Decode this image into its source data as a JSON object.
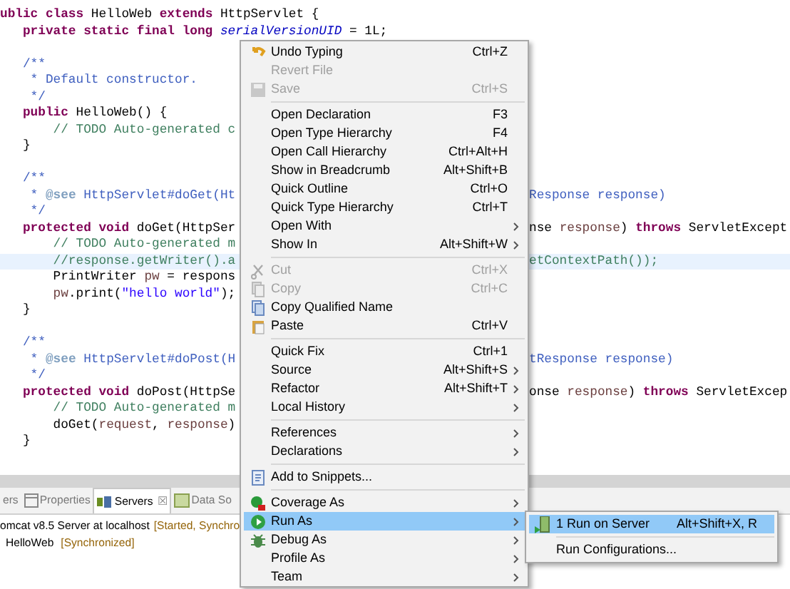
{
  "editor": {
    "lines": [
      {
        "current": false,
        "left": [
          {
            "kind": "keyword",
            "text": "ublic class"
          },
          {
            "kind": "plain",
            "text": " HelloWeb "
          },
          {
            "kind": "keyword",
            "text": "extends"
          },
          {
            "kind": "plain",
            "text": " HttpServlet {"
          }
        ]
      },
      {
        "current": false,
        "left": [
          {
            "kind": "keyword",
            "text": "   private static final long"
          },
          {
            "kind": "field",
            "text": " serialVersionUID"
          },
          {
            "kind": "plain",
            "text": " = 1L;"
          }
        ]
      },
      {
        "current": false
      },
      {
        "current": false,
        "left": [
          {
            "kind": "javadoc",
            "text": "   /**"
          }
        ]
      },
      {
        "current": false,
        "left": [
          {
            "kind": "javadoc",
            "text": "    * Default constructor."
          }
        ]
      },
      {
        "current": false,
        "left": [
          {
            "kind": "javadoc",
            "text": "    */"
          }
        ]
      },
      {
        "current": false,
        "left": [
          {
            "kind": "keyword",
            "text": "   public"
          },
          {
            "kind": "plain",
            "text": " HelloWeb() {"
          }
        ]
      },
      {
        "current": false,
        "left": [
          {
            "kind": "comment",
            "text": "       // TODO Auto-generated c"
          }
        ]
      },
      {
        "current": false,
        "left": [
          {
            "kind": "plain",
            "text": "   }"
          }
        ]
      },
      {
        "current": false
      },
      {
        "current": false,
        "left": [
          {
            "kind": "javadoc",
            "text": "   /**"
          }
        ]
      },
      {
        "current": false,
        "left": [
          {
            "kind": "javadoc",
            "text": "    * "
          },
          {
            "kind": "doctag",
            "text": "@see"
          },
          {
            "kind": "javadoc",
            "text": " HttpServlet#doGet(Ht"
          }
        ],
        "right": [
          {
            "kind": "javadoc",
            "text": "Response response)"
          }
        ]
      },
      {
        "current": false,
        "left": [
          {
            "kind": "javadoc",
            "text": "    */"
          }
        ]
      },
      {
        "current": false,
        "left": [
          {
            "kind": "keyword",
            "text": "   protected void"
          },
          {
            "kind": "plain",
            "text": " doGet(HttpSer"
          }
        ],
        "right": [
          {
            "kind": "plain",
            "text": "nse "
          },
          {
            "kind": "param",
            "text": "response"
          },
          {
            "kind": "plain",
            "text": ") "
          },
          {
            "kind": "keyword",
            "text": "throws"
          },
          {
            "kind": "plain",
            "text": " ServletExcept"
          }
        ]
      },
      {
        "current": false,
        "left": [
          {
            "kind": "comment",
            "text": "       // TODO Auto-generated m"
          }
        ]
      },
      {
        "current": true,
        "left": [
          {
            "kind": "comment",
            "text": "       //response.getWriter().a"
          }
        ],
        "right": [
          {
            "kind": "comment",
            "text": "etContextPath());"
          }
        ]
      },
      {
        "current": false,
        "left": [
          {
            "kind": "plain",
            "text": "       PrintWriter "
          },
          {
            "kind": "param",
            "text": "pw"
          },
          {
            "kind": "plain",
            "text": " = respons"
          }
        ]
      },
      {
        "current": false,
        "left": [
          {
            "kind": "param",
            "text": "       pw"
          },
          {
            "kind": "plain",
            "text": ".print("
          },
          {
            "kind": "string",
            "text": "\"hello world\""
          },
          {
            "kind": "plain",
            "text": ");"
          }
        ]
      },
      {
        "current": false,
        "left": [
          {
            "kind": "plain",
            "text": "   }"
          }
        ]
      },
      {
        "current": false
      },
      {
        "current": false,
        "left": [
          {
            "kind": "javadoc",
            "text": "   /**"
          }
        ]
      },
      {
        "current": false,
        "left": [
          {
            "kind": "javadoc",
            "text": "    * "
          },
          {
            "kind": "doctag",
            "text": "@see"
          },
          {
            "kind": "javadoc",
            "text": " HttpServlet#doPost(H"
          }
        ],
        "right": [
          {
            "kind": "javadoc",
            "text": "tResponse response)"
          }
        ]
      },
      {
        "current": false,
        "left": [
          {
            "kind": "javadoc",
            "text": "    */"
          }
        ]
      },
      {
        "current": false,
        "left": [
          {
            "kind": "keyword",
            "text": "   protected void"
          },
          {
            "kind": "plain",
            "text": " doPost(HttpSe"
          }
        ],
        "right": [
          {
            "kind": "plain",
            "text": "onse "
          },
          {
            "kind": "param",
            "text": "response"
          },
          {
            "kind": "plain",
            "text": ") "
          },
          {
            "kind": "keyword",
            "text": "throws"
          },
          {
            "kind": "plain",
            "text": " ServletExcep"
          }
        ]
      },
      {
        "current": false,
        "left": [
          {
            "kind": "comment",
            "text": "       // TODO Auto-generated m"
          }
        ]
      },
      {
        "current": false,
        "left": [
          {
            "kind": "plain",
            "text": "       doGet("
          },
          {
            "kind": "param",
            "text": "request"
          },
          {
            "kind": "plain",
            "text": ", "
          },
          {
            "kind": "param",
            "text": "response"
          },
          {
            "kind": "plain",
            "text": ")"
          }
        ]
      },
      {
        "current": false,
        "left": [
          {
            "kind": "plain",
            "text": "   }"
          }
        ]
      }
    ]
  },
  "bottom_panel": {
    "tabs": [
      {
        "label": "ers",
        "selected": false
      },
      {
        "label": "Properties",
        "selected": false
      },
      {
        "label": "Servers",
        "selected": true,
        "close": "☒"
      },
      {
        "label": "Data So",
        "selected": false
      }
    ],
    "servers": [
      {
        "name": "omcat v8.5 Server at localhost",
        "status": "[Started, Synchro",
        "children": [
          {
            "name": "HelloWeb",
            "status": "[Synchronized]"
          }
        ]
      }
    ]
  },
  "context_menu": {
    "items": [
      {
        "kind": "item",
        "label": "Undo Typing",
        "shortcut": "Ctrl+Z",
        "disabled": false,
        "submenu": false,
        "selected": false
      },
      {
        "kind": "item",
        "label": "Revert File",
        "disabled": true,
        "submenu": false,
        "selected": false
      },
      {
        "kind": "item",
        "label": "Save",
        "shortcut": "Ctrl+S",
        "disabled": true,
        "submenu": false,
        "selected": false
      },
      {
        "kind": "separator"
      },
      {
        "kind": "item",
        "label": "Open Declaration",
        "shortcut": "F3",
        "disabled": false,
        "submenu": false,
        "selected": false
      },
      {
        "kind": "item",
        "label": "Open Type Hierarchy",
        "shortcut": "F4",
        "disabled": false,
        "submenu": false,
        "selected": false
      },
      {
        "kind": "item",
        "label": "Open Call Hierarchy",
        "shortcut": "Ctrl+Alt+H",
        "disabled": false,
        "submenu": false,
        "selected": false
      },
      {
        "kind": "item",
        "label": "Show in Breadcrumb",
        "shortcut": "Alt+Shift+B",
        "disabled": false,
        "submenu": false,
        "selected": false
      },
      {
        "kind": "item",
        "label": "Quick Outline",
        "shortcut": "Ctrl+O",
        "disabled": false,
        "submenu": false,
        "selected": false
      },
      {
        "kind": "item",
        "label": "Quick Type Hierarchy",
        "shortcut": "Ctrl+T",
        "disabled": false,
        "submenu": false,
        "selected": false
      },
      {
        "kind": "item",
        "label": "Open With",
        "disabled": false,
        "submenu": true,
        "selected": false
      },
      {
        "kind": "item",
        "label": "Show In",
        "shortcut": "Alt+Shift+W",
        "disabled": false,
        "submenu": true,
        "selected": false
      },
      {
        "kind": "separator"
      },
      {
        "kind": "item",
        "label": "Cut",
        "shortcut": "Ctrl+X",
        "disabled": true,
        "submenu": false,
        "selected": false
      },
      {
        "kind": "item",
        "label": "Copy",
        "shortcut": "Ctrl+C",
        "disabled": true,
        "submenu": false,
        "selected": false
      },
      {
        "kind": "item",
        "label": "Copy Qualified Name",
        "disabled": false,
        "submenu": false,
        "selected": false
      },
      {
        "kind": "item",
        "label": "Paste",
        "shortcut": "Ctrl+V",
        "disabled": false,
        "submenu": false,
        "selected": false
      },
      {
        "kind": "separator"
      },
      {
        "kind": "item",
        "label": "Quick Fix",
        "shortcut": "Ctrl+1",
        "disabled": false,
        "submenu": false,
        "selected": false
      },
      {
        "kind": "item",
        "label": "Source",
        "shortcut": "Alt+Shift+S",
        "disabled": false,
        "submenu": true,
        "selected": false
      },
      {
        "kind": "item",
        "label": "Refactor",
        "shortcut": "Alt+Shift+T",
        "disabled": false,
        "submenu": true,
        "selected": false
      },
      {
        "kind": "item",
        "label": "Local History",
        "disabled": false,
        "submenu": true,
        "selected": false
      },
      {
        "kind": "separator"
      },
      {
        "kind": "item",
        "label": "References",
        "disabled": false,
        "submenu": true,
        "selected": false
      },
      {
        "kind": "item",
        "label": "Declarations",
        "disabled": false,
        "submenu": true,
        "selected": false
      },
      {
        "kind": "separator"
      },
      {
        "kind": "item",
        "label": "Add to Snippets...",
        "disabled": false,
        "submenu": false,
        "selected": false
      },
      {
        "kind": "separator"
      },
      {
        "kind": "item",
        "label": "Coverage As",
        "disabled": false,
        "submenu": true,
        "selected": false
      },
      {
        "kind": "item",
        "label": "Run As",
        "disabled": false,
        "submenu": true,
        "selected": true
      },
      {
        "kind": "item",
        "label": "Debug As",
        "disabled": false,
        "submenu": true,
        "selected": false
      },
      {
        "kind": "item",
        "label": "Profile As",
        "disabled": false,
        "submenu": true,
        "selected": false
      },
      {
        "kind": "item",
        "label": "Team",
        "disabled": false,
        "submenu": true,
        "selected": false
      }
    ]
  },
  "submenu": {
    "items": [
      {
        "kind": "item",
        "label": "1 Run on Server",
        "shortcut": "Alt+Shift+X, R",
        "selected": true
      },
      {
        "kind": "separator"
      },
      {
        "kind": "item",
        "label": "Run Configurations...",
        "selected": false
      }
    ]
  }
}
